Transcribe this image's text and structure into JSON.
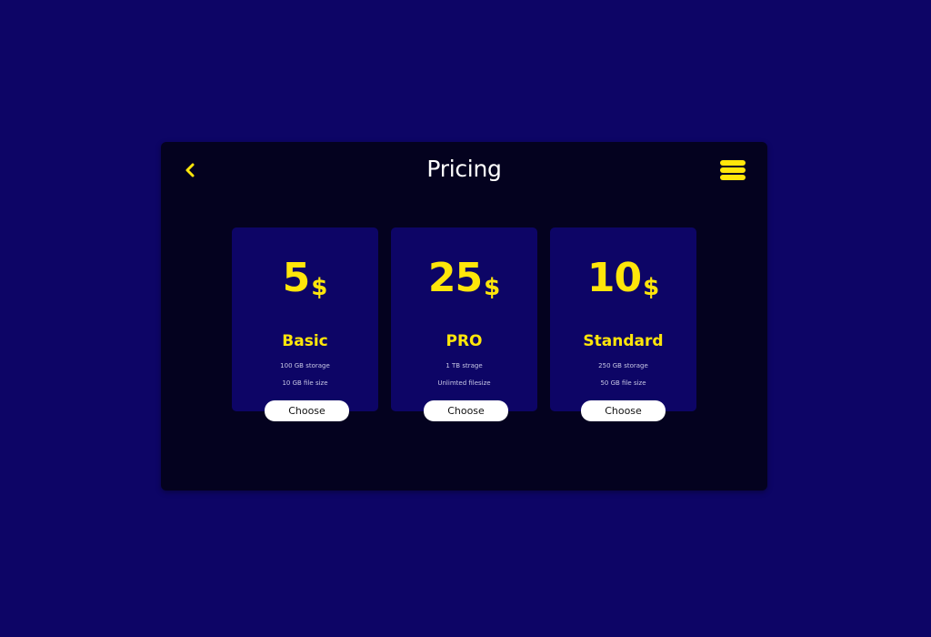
{
  "header": {
    "back_icon": "chevron-left-icon",
    "title": "Pricing",
    "menu_icon": "hamburger-menu-icon"
  },
  "plans": [
    {
      "amount": "5",
      "currency": "$",
      "name": "Basic",
      "features": [
        "100 GB storage",
        "10 GB file size"
      ],
      "button_label": "Choose"
    },
    {
      "amount": "25",
      "currency": "$",
      "name": "PRO",
      "features": [
        "1 TB strage",
        "Unlimted filesize"
      ],
      "button_label": "Choose"
    },
    {
      "amount": "10",
      "currency": "$",
      "name": "Standard",
      "features": [
        "250 GB storage",
        "50 GB file size"
      ],
      "button_label": "Choose"
    }
  ],
  "colors": {
    "background": "#0d0566",
    "panel": "#04021f",
    "card": "#0d0566",
    "accent": "#ffe60a",
    "title": "#ffffff",
    "button": "#ffffff"
  }
}
